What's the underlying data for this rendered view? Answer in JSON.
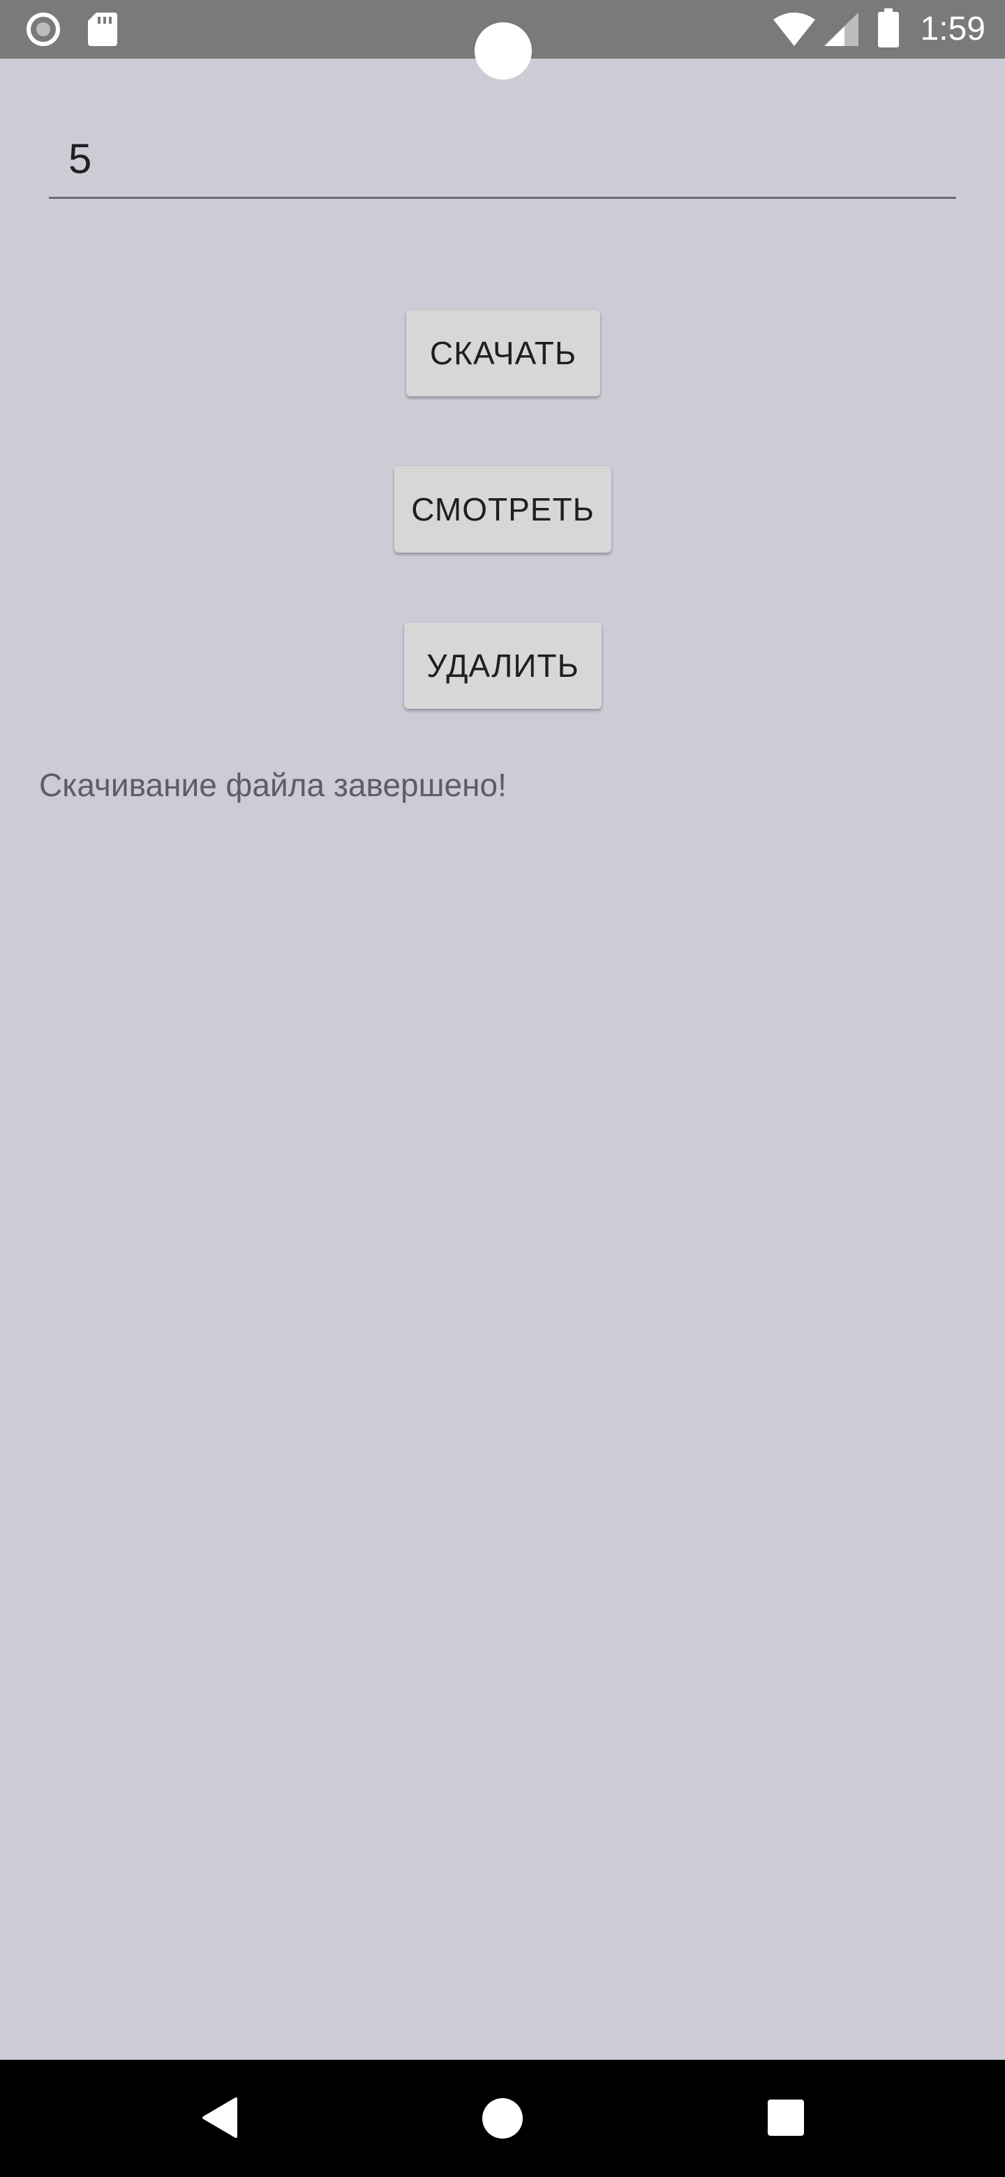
{
  "status_bar": {
    "time": "1:59",
    "icons": [
      "record-icon",
      "sd-card-icon",
      "wifi-icon",
      "signal-icon",
      "battery-icon"
    ]
  },
  "form": {
    "number_input_value": "5"
  },
  "buttons": {
    "download_label": "СКАЧАТЬ",
    "view_label": "СМОТРЕТЬ",
    "delete_label": "УДАЛИТЬ"
  },
  "status": {
    "message": "Скачивание файла завершено!"
  },
  "nav_bar": {
    "icons": [
      "back-icon",
      "home-icon",
      "recents-icon"
    ]
  },
  "colors": {
    "background": "#cecbd7",
    "status_bar": "#7a7a7a",
    "button": "#d7d7d7",
    "nav_bar": "#000000"
  }
}
